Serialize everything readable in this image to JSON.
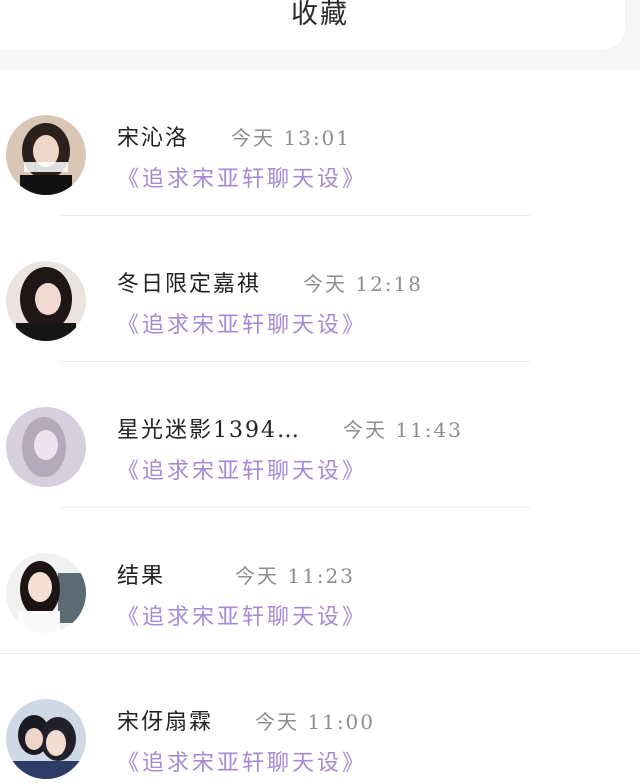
{
  "header": {
    "title": "收藏"
  },
  "items": [
    {
      "name": "宋沁洛",
      "time": "今天 13:01",
      "subtitle": "《追求宋亚轩聊天设》"
    },
    {
      "name": "冬日限定嘉祺",
      "time": "今天 12:18",
      "subtitle": "《追求宋亚轩聊天设》"
    },
    {
      "name": "星光迷影1394…",
      "time": "今天 11:43",
      "subtitle": "《追求宋亚轩聊天设》"
    },
    {
      "name": "结果",
      "time": "今天 11:23",
      "subtitle": "《追求宋亚轩聊天设》"
    },
    {
      "name": "宋伢扇霖",
      "time": "今天 11:00",
      "subtitle": "《追求宋亚轩聊天设》"
    }
  ],
  "colors": {
    "accent": "#a58ad6",
    "time": "#8d8d8d",
    "text": "#222222",
    "background": "#f7f6f7"
  }
}
